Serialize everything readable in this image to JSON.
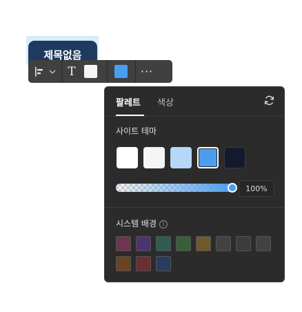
{
  "node": {
    "title": "제목없음"
  },
  "toolbar": {
    "text_glyph": "T",
    "more_glyph": "···",
    "colors": {
      "fill": "#f5f5f5",
      "accent": "#4a9ef0"
    }
  },
  "panel": {
    "tabs": [
      {
        "label": "팔레트",
        "active": true
      },
      {
        "label": "색상",
        "active": false
      }
    ],
    "site_theme": {
      "title": "사이트 테마",
      "swatches": [
        {
          "color": "#ffffff",
          "selected": false
        },
        {
          "color": "#f5f5f5",
          "selected": false
        },
        {
          "color": "#b6d7f7",
          "selected": false
        },
        {
          "color": "#4a9ef0",
          "selected": true
        },
        {
          "color": "#131a2e",
          "selected": false
        }
      ],
      "opacity": {
        "value": 100,
        "label": "100%"
      }
    },
    "system_bg": {
      "title": "시스템 배경",
      "info_glyph": "i",
      "swatches": [
        "#6e3551",
        "#4a3570",
        "#2f5c50",
        "#385f37",
        "#6e5a2c",
        "#424242",
        "#3c3c3c",
        "#424242",
        "#6a4226",
        "#6a2e33",
        "#2a3b60"
      ]
    }
  }
}
